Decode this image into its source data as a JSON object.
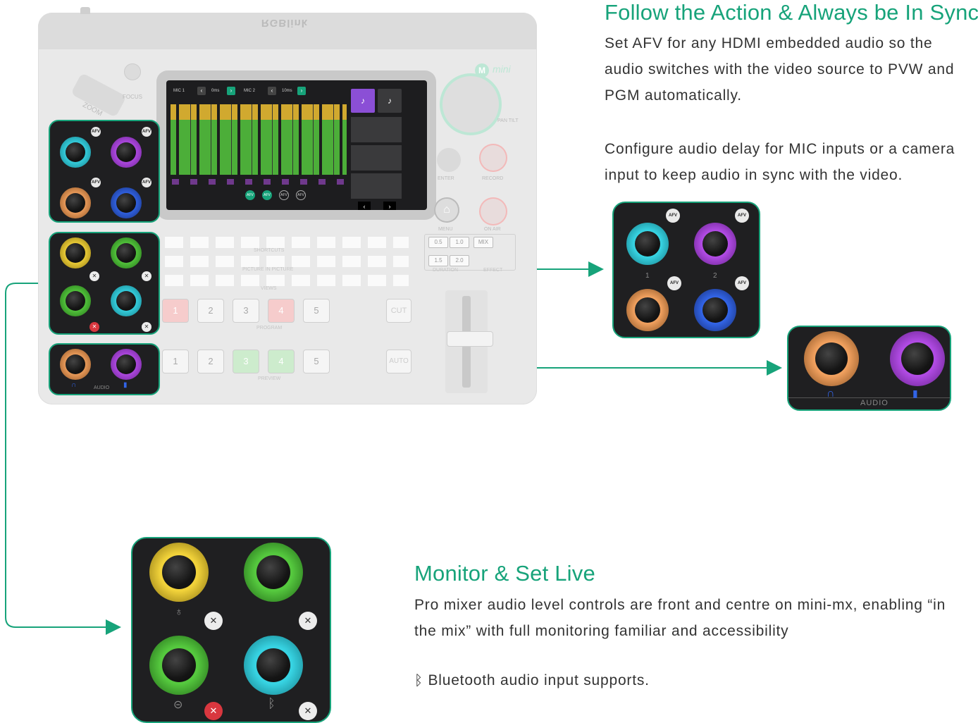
{
  "sections": {
    "sync": {
      "heading": "Follow the Action & Always be In Sync",
      "paragraph1": "Set AFV for any HDMI embedded audio so the\naudio switches with the video source to PVW and\nPGM automatically.",
      "paragraph2": "Configure audio delay for MIC inputs or a camera\ninput to keep audio in sync with the video."
    },
    "monitor": {
      "heading": "Monitor & Set Live",
      "paragraph1": "Pro mixer audio level controls are front and centre on mini-mx, enabling “in\nthe mix” with full monitoring familiar and accessibility",
      "bluetooth_line": "Bluetooth audio input supports."
    }
  },
  "device": {
    "brand": "RGBlink",
    "logo": "mini",
    "screen": {
      "mic1_label": "MIC 1",
      "mic1_delay": "0ms",
      "mic2_label": "MIC 2",
      "mic2_delay": "10ms",
      "afv_badges": [
        "AFV",
        "AFV",
        "AFV",
        "AFV"
      ]
    },
    "labels": {
      "zoom": "ZOOM",
      "focus": "FOCUS",
      "pan_tilt": "PAN TILT",
      "enter": "ENTER",
      "record": "RECORD",
      "menu": "MENU",
      "on_air": "ON AIR",
      "shortcuts": "SHORTCUTS",
      "pip": "PICTURE IN PICTURE",
      "views": "VIEWS",
      "program": "PROGRAM",
      "preview": "PREVIEW",
      "duration": "DURATION",
      "effect": "EFFECT",
      "cut": "CUT",
      "auto": "AUTO",
      "audio": "AUDIO",
      "mix": "MIX"
    },
    "program_buttons": [
      "1",
      "2",
      "3",
      "4",
      "5"
    ],
    "preview_buttons": [
      "1",
      "2",
      "3",
      "4",
      "5"
    ],
    "duration_buttons": [
      "0.5",
      "1.0",
      "1.5",
      "2.0"
    ]
  },
  "zoom_panels": {
    "afv_panel": {
      "knob_labels": [
        "1",
        "2"
      ],
      "badge": "AFV"
    },
    "audio_panel": {
      "label": "AUDIO"
    }
  },
  "colors": {
    "accent": "#17a37a",
    "knob_cyan": "#37d3e2",
    "knob_purple": "#b14be4",
    "knob_orange": "#f0a05e",
    "knob_blue": "#3264e6",
    "knob_yellow": "#f1d23a",
    "knob_green": "#55c83e",
    "program_red": "#f6b9b9",
    "preview_green": "#bfe7bf"
  },
  "icons": [
    "bluetooth-icon",
    "headphone-icon",
    "speaker-icon",
    "microphone-icon",
    "mute-icon",
    "home-icon",
    "record-icon",
    "on-air-icon",
    "input-icon"
  ]
}
